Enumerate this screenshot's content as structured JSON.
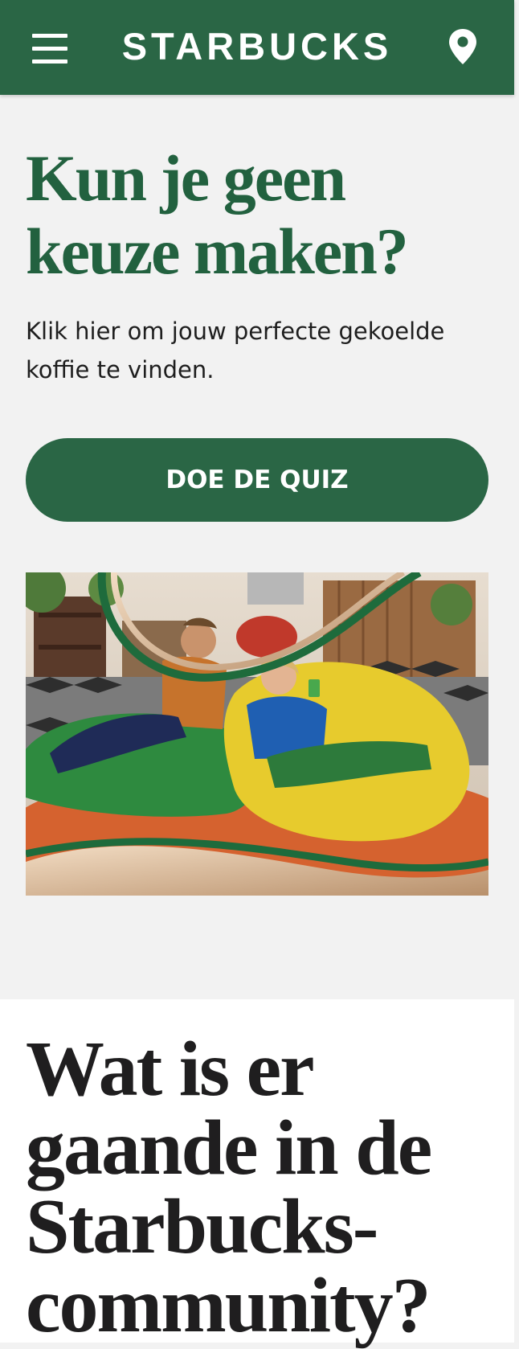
{
  "header": {
    "brand": "STARBUCKS",
    "menu_icon": "hamburger-menu-icon",
    "location_icon": "location-pin-icon",
    "bar_color": "#2a6645"
  },
  "hero": {
    "title": "Kun je geen keuze maken?",
    "text": "Klik hier om jouw perfecte gekoelde koffie te vinden.",
    "cta_label": "DOE DE QUIZ",
    "image_subject": "Two people relaxing on green and yellow beanbags looking at their phones",
    "title_color": "#22613f"
  },
  "community": {
    "title": "Wat is er gaande in de Starbucks-community?"
  }
}
